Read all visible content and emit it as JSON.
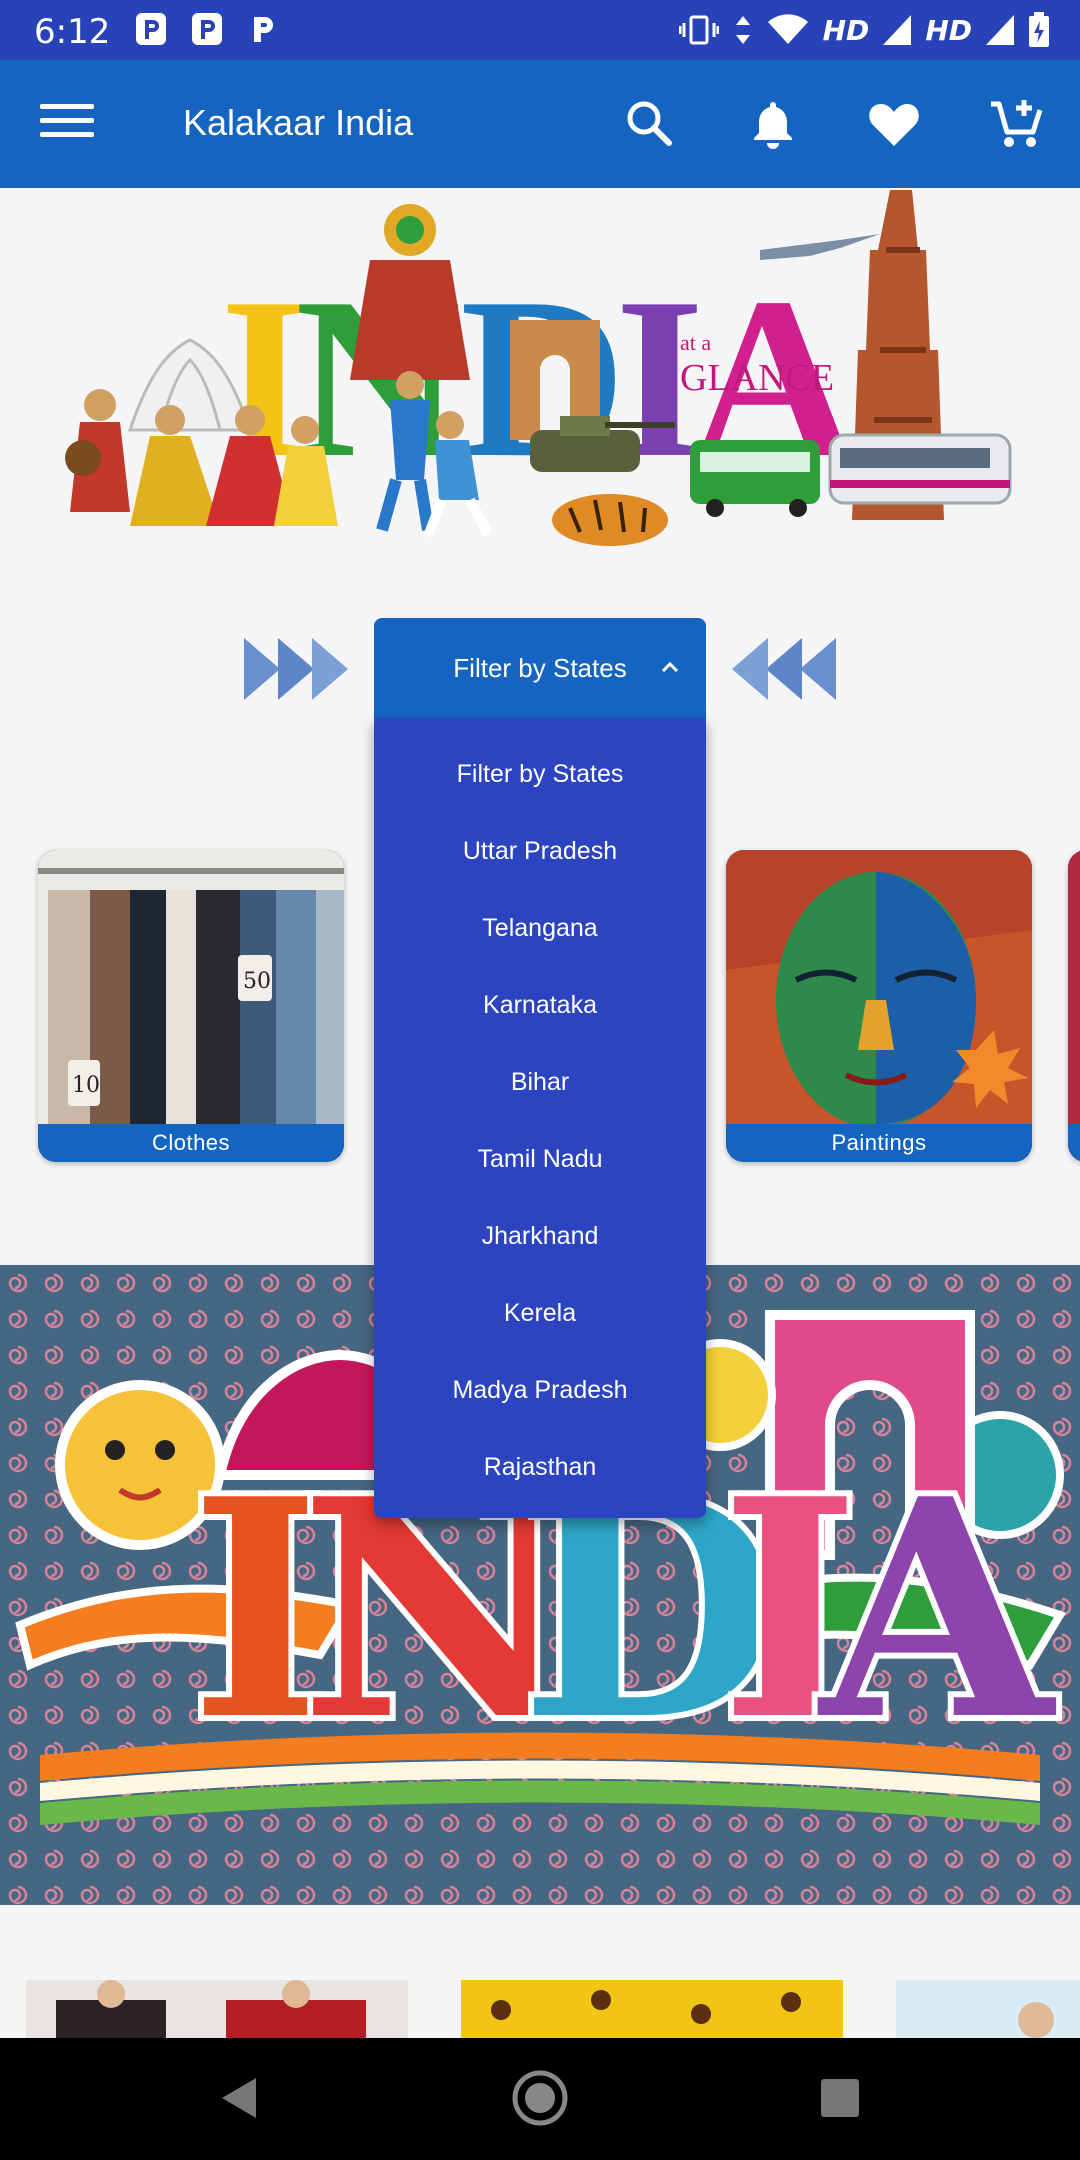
{
  "status_bar": {
    "time": "6:12",
    "hd_label_1": "HD",
    "hd_label_2": "HD"
  },
  "app_bar": {
    "title": "Kalakaar India",
    "icons": [
      "menu-icon",
      "search-icon",
      "bell-icon",
      "heart-icon",
      "cart-icon"
    ]
  },
  "banner": {
    "headline": "INDIA",
    "tagline_small": "at a",
    "tagline": "GLANCE"
  },
  "filter": {
    "label": "Filter by States",
    "options": [
      "Filter by States",
      "Uttar Pradesh",
      "Telangana",
      "Karnataka",
      "Bihar",
      "Tamil Nadu",
      "Jharkhand",
      "Kerela",
      "Madya Pradesh",
      "Rajasthan"
    ]
  },
  "categories": [
    {
      "label": "Clothes"
    },
    {
      "label": "Paintings"
    }
  ],
  "art": {
    "word": "INDIA"
  },
  "colors": {
    "status_bar": "#2843b8",
    "app_bar": "#1565c0",
    "dropdown": "#2c44bf",
    "background": "#f5f5f7"
  }
}
